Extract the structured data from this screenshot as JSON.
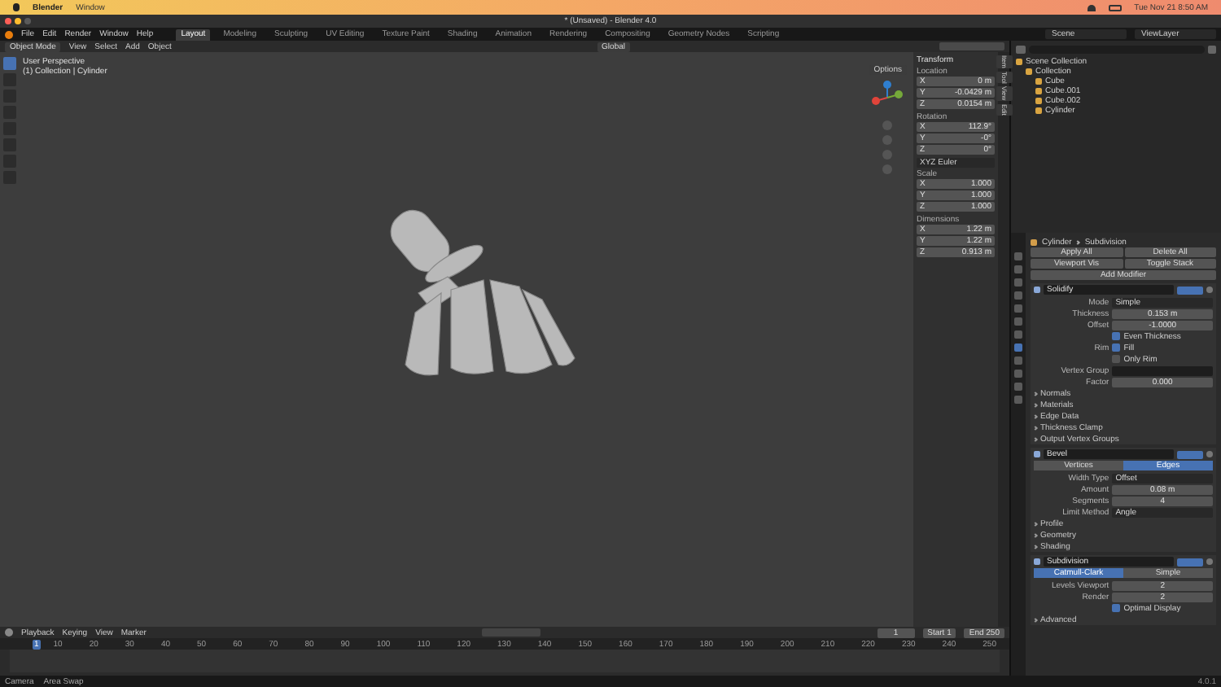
{
  "mac_menubar": {
    "app": "Blender",
    "items": [
      "Window"
    ],
    "clock": "Tue Nov 21  8:50 AM"
  },
  "window": {
    "title": "* (Unsaved) - Blender 4.0"
  },
  "menus": [
    "File",
    "Edit",
    "Render",
    "Window",
    "Help"
  ],
  "workspaces": [
    {
      "label": "Layout",
      "selected": true
    },
    {
      "label": "Modeling",
      "selected": false
    },
    {
      "label": "Sculpting",
      "selected": false
    },
    {
      "label": "UV Editing",
      "selected": false
    },
    {
      "label": "Texture Paint",
      "selected": false
    },
    {
      "label": "Shading",
      "selected": false
    },
    {
      "label": "Animation",
      "selected": false
    },
    {
      "label": "Rendering",
      "selected": false
    },
    {
      "label": "Compositing",
      "selected": false
    },
    {
      "label": "Geometry Nodes",
      "selected": false
    },
    {
      "label": "Scripting",
      "selected": false
    }
  ],
  "scene": {
    "scene": "Scene",
    "view_layer": "ViewLayer"
  },
  "viewport": {
    "mode": "Object Mode",
    "menus": [
      "View",
      "Select",
      "Add",
      "Object"
    ],
    "orientation": "Global",
    "options": "Options",
    "info": [
      "User Perspective",
      "(1) Collection | Cylinder"
    ],
    "tools": [
      {
        "selected": true
      },
      {
        "selected": false
      },
      {
        "selected": false
      },
      {
        "selected": false
      },
      {
        "selected": false
      },
      {
        "selected": false
      },
      {
        "selected": false
      },
      {
        "selected": false
      }
    ]
  },
  "sidebar": {
    "tabs": [
      "Item",
      "Tool",
      "View",
      "Edit"
    ],
    "transform": {
      "title": "Transform",
      "groups": [
        {
          "label": "Location",
          "rows": [
            {
              "axis": "X",
              "value": "0 m"
            },
            {
              "axis": "Y",
              "value": "-0.0429 m"
            },
            {
              "axis": "Z",
              "value": "0.0154 m"
            }
          ]
        },
        {
          "label": "Rotation",
          "rows": [
            {
              "axis": "X",
              "value": "112.9°"
            },
            {
              "axis": "Y",
              "value": "-0°"
            },
            {
              "axis": "Z",
              "value": "0°"
            }
          ],
          "mode": "XYZ Euler"
        },
        {
          "label": "Scale",
          "rows": [
            {
              "axis": "X",
              "value": "1.000"
            },
            {
              "axis": "Y",
              "value": "1.000"
            },
            {
              "axis": "Z",
              "value": "1.000"
            }
          ]
        },
        {
          "label": "Dimensions",
          "rows": [
            {
              "axis": "X",
              "value": "1.22 m"
            },
            {
              "axis": "Y",
              "value": "1.22 m"
            },
            {
              "axis": "Z",
              "value": "0.913 m"
            }
          ]
        }
      ]
    }
  },
  "outliner": {
    "items": [
      {
        "label": "Scene Collection",
        "children": [
          {
            "label": "Collection",
            "children": [
              {
                "label": "Cube"
              },
              {
                "label": "Cube.001"
              },
              {
                "label": "Cube.002"
              },
              {
                "label": "Cylinder"
              }
            ]
          }
        ]
      }
    ]
  },
  "properties": {
    "object": "Cylinder",
    "modifier": "Subdivision",
    "actions": [
      "Apply All",
      "Delete All",
      "Viewport Vis",
      "Toggle Stack"
    ],
    "add": "Add Modifier",
    "modifiers": [
      {
        "name": "Solidify",
        "rows": [
          {
            "kind": "dropdown",
            "label": "Mode",
            "value": "Simple"
          },
          {
            "kind": "number",
            "label": "Thickness",
            "value": "0.153 m"
          },
          {
            "kind": "number",
            "label": "Offset",
            "value": "-1.0000"
          },
          {
            "kind": "check",
            "label": "Even Thickness",
            "checked": true
          },
          {
            "kind": "check",
            "label": "Rim",
            "value": "Fill",
            "checked": true
          },
          {
            "kind": "check",
            "label": "Only Rim",
            "checked": false
          },
          {
            "kind": "field",
            "label": "Vertex Group"
          },
          {
            "kind": "number",
            "label": "Factor",
            "value": "0.000"
          }
        ],
        "subpanels": [
          "Normals",
          "Materials",
          "Edge Data",
          "Thickness Clamp",
          "Output Vertex Groups"
        ]
      },
      {
        "name": "Bevel",
        "segments": [
          {
            "label": "Vertices",
            "selected": false
          },
          {
            "label": "Edges",
            "selected": true
          }
        ],
        "rows": [
          {
            "kind": "dropdown",
            "label": "Width Type",
            "value": "Offset"
          },
          {
            "kind": "number",
            "label": "Amount",
            "value": "0.08 m"
          },
          {
            "kind": "number",
            "label": "Segments",
            "value": "4"
          },
          {
            "kind": "dropdown",
            "label": "Limit Method",
            "value": "Angle"
          }
        ],
        "subpanels": [
          "Profile",
          "Geometry",
          "Shading"
        ]
      },
      {
        "name": "Subdivision",
        "segments": [
          {
            "label": "Catmull-Clark",
            "selected": true
          },
          {
            "label": "Simple",
            "selected": false
          }
        ],
        "rows": [
          {
            "kind": "number",
            "label": "Levels Viewport",
            "value": "2"
          },
          {
            "kind": "number",
            "label": "Render",
            "value": "2"
          },
          {
            "kind": "check",
            "label": "Optimal Display",
            "checked": true
          }
        ],
        "subpanels": [
          "Advanced"
        ]
      }
    ]
  },
  "timeline": {
    "menus": [
      "Playback",
      "Keying",
      "View",
      "Marker"
    ],
    "current": "1",
    "playhead": "1",
    "start_label": "Start",
    "start": "1",
    "end_label": "End",
    "end": "250",
    "ticks": [
      "10",
      "20",
      "30",
      "40",
      "50",
      "60",
      "70",
      "80",
      "90",
      "100",
      "110",
      "120",
      "130",
      "140",
      "150",
      "160",
      "170",
      "180",
      "190",
      "200",
      "210",
      "220",
      "230",
      "240",
      "250"
    ]
  },
  "status": {
    "items": [
      "Camera",
      "Area Swap"
    ],
    "version": "4.0.1"
  }
}
